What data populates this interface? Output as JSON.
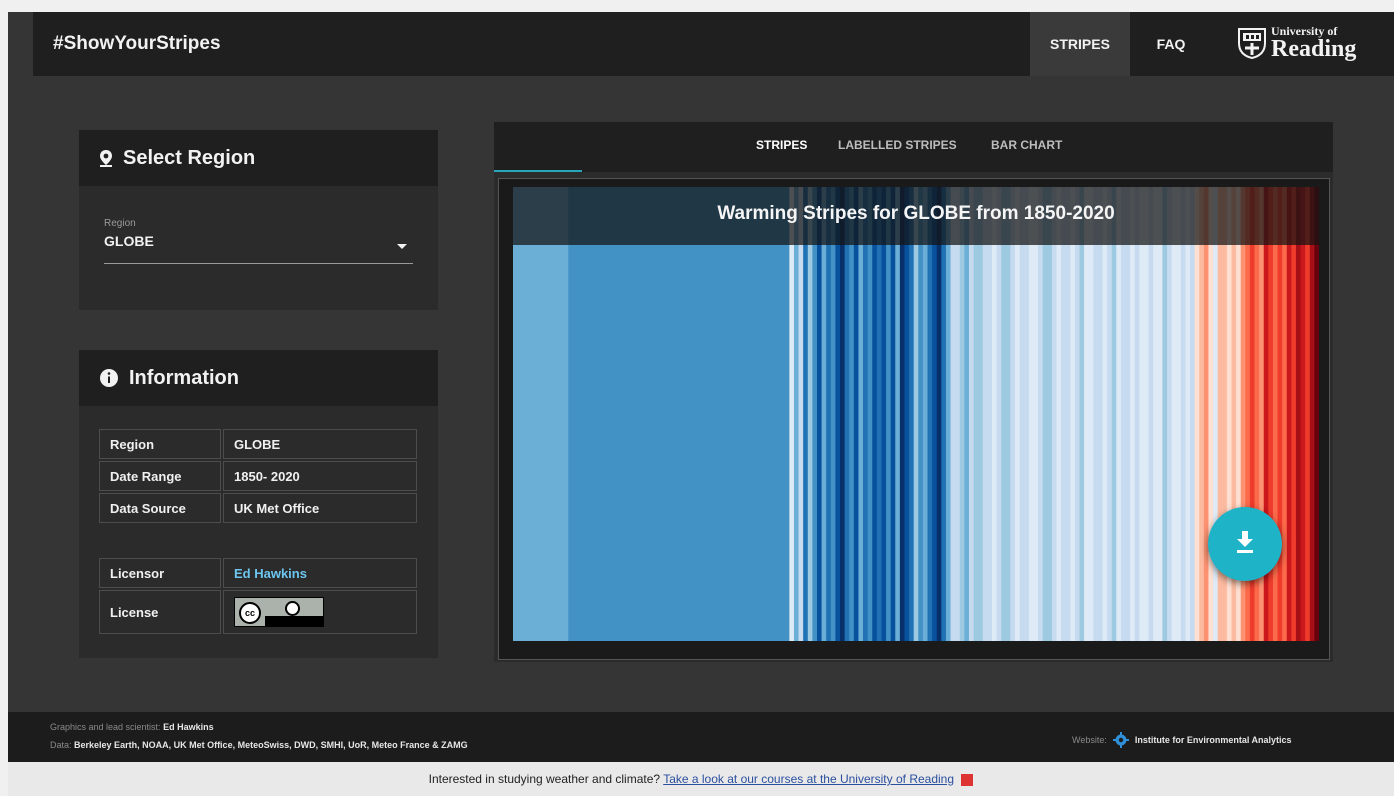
{
  "header": {
    "brand": "#ShowYourStripes",
    "nav": [
      "STRIPES",
      "FAQ"
    ],
    "logo_small": "University of",
    "logo_big": "Reading"
  },
  "region_card": {
    "title": "Select Region",
    "field_label": "Region",
    "field_value": "GLOBE"
  },
  "info_card": {
    "title": "Information",
    "rows": [
      {
        "k": "Region",
        "v": "GLOBE"
      },
      {
        "k": "Date Range",
        "v": "1850- 2020"
      },
      {
        "k": "Data Source",
        "v": "UK Met Office"
      }
    ],
    "licensor_label": "Licensor",
    "licensor_value": "Ed Hawkins",
    "license_label": "License",
    "license_badge": "cc"
  },
  "viz": {
    "tabs": [
      "STRIPES",
      "LABELLED STRIPES",
      "BAR CHART"
    ],
    "active_tab": "STRIPES",
    "title": "Warming Stripes for GLOBE from 1850-2020",
    "colors": [
      "#08306b",
      "#08519c",
      "#2171b5",
      "#4292c6",
      "#6baed6",
      "#9ecae1",
      "#c6dbef",
      "#deebf7",
      "#fee0d2",
      "#fcbba1",
      "#fc9272",
      "#fb6a4a",
      "#ef3b2c",
      "#cb181d",
      "#a50f15",
      "#67000d"
    ],
    "stripe_levels": [
      4,
      4,
      4,
      4,
      4,
      4,
      4,
      4,
      4,
      4,
      4,
      4,
      3,
      3,
      3,
      3,
      3,
      3,
      3,
      3,
      3,
      3,
      3,
      3,
      3,
      3,
      3,
      3,
      3,
      3,
      3,
      3,
      3,
      3,
      3,
      3,
      3,
      3,
      3,
      3,
      3,
      3,
      3,
      3,
      3,
      3,
      3,
      3,
      3,
      3,
      3,
      3,
      3,
      3,
      3,
      3,
      3,
      3,
      3,
      3,
      7,
      4,
      6,
      2,
      5,
      3,
      1,
      4,
      2,
      3,
      1,
      0,
      2,
      3,
      1,
      4,
      2,
      3,
      1,
      2,
      1,
      3,
      1,
      4,
      0,
      1,
      2,
      5,
      3,
      4,
      2,
      1,
      0,
      2,
      4,
      6,
      6,
      5,
      4,
      6,
      5,
      5,
      6,
      6,
      7,
      6,
      5,
      5,
      6,
      7,
      6,
      6,
      7,
      7,
      6,
      5,
      5,
      6,
      7,
      6,
      6,
      7,
      6,
      5,
      7,
      7,
      6,
      6,
      7,
      6,
      5,
      7,
      6,
      6,
      7,
      6,
      7,
      7,
      6,
      7,
      7,
      5,
      6,
      7,
      7,
      6,
      7,
      6,
      8,
      9,
      10,
      8,
      7,
      9,
      9,
      8,
      9,
      8,
      10,
      11,
      12,
      11,
      10,
      13,
      12,
      11,
      12,
      11,
      13,
      12,
      14,
      13,
      12,
      14,
      15
    ]
  },
  "footer": {
    "line1_label": "Graphics and lead scientist:",
    "line1_value": "Ed Hawkins",
    "line2_label": "Data:",
    "line2_value": "Berkeley Earth, NOAA, UK Met Office, MeteoSwiss, DWD, SMHI, UoR, Meteo France & ZAMG",
    "website_label": "Website:",
    "website_value": "Institute for Environmental Analytics",
    "bottom_text": "Interested in studying weather and climate?",
    "bottom_link": "Take a look at our courses at the University of Reading"
  }
}
